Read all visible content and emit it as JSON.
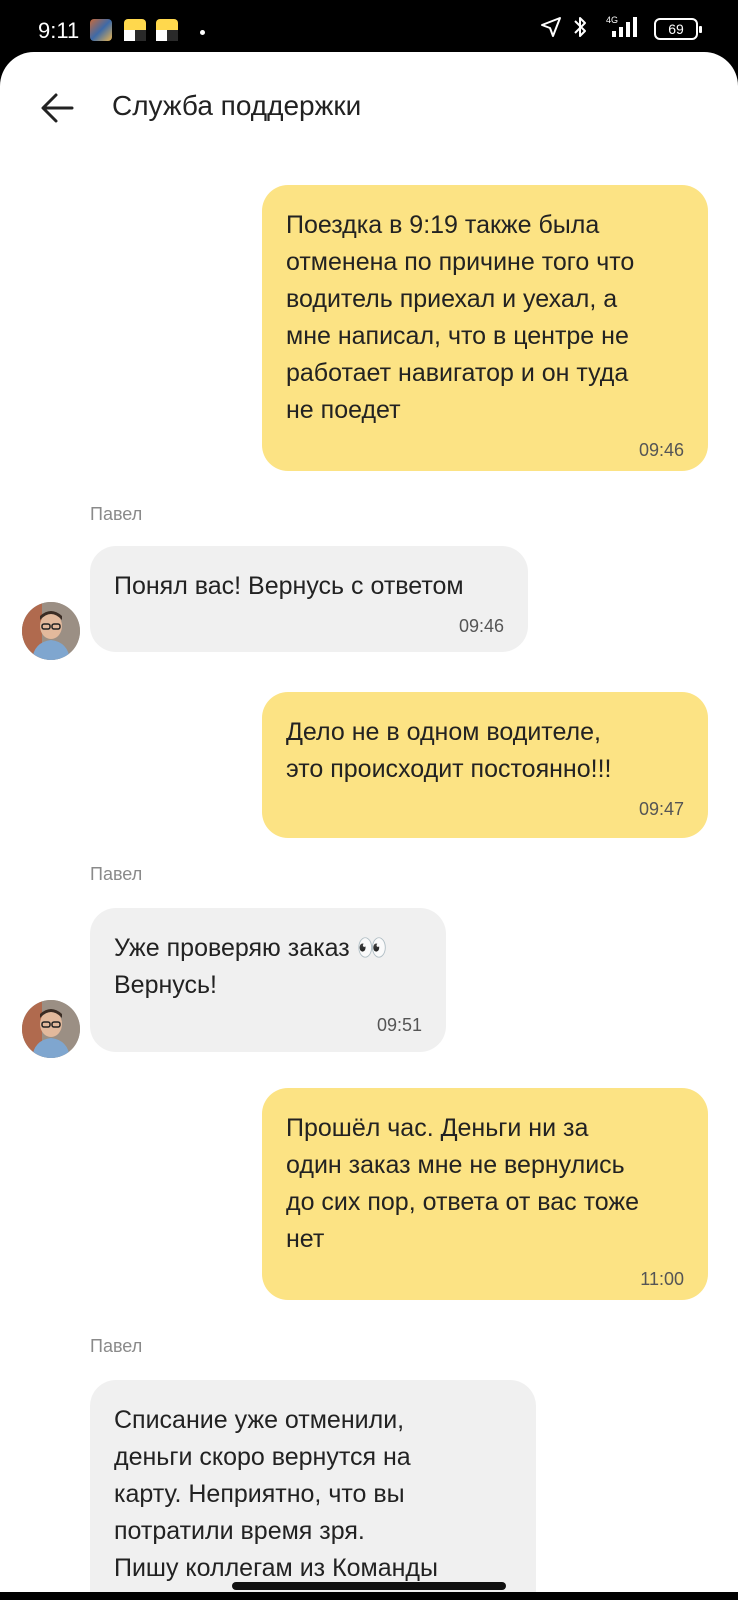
{
  "status_bar": {
    "time": "9:11",
    "network": "4G",
    "battery": "69"
  },
  "header": {
    "title": "Служба поддержки",
    "back_icon": "arrow-left-icon"
  },
  "messages": [
    {
      "direction": "out",
      "text": "Поездка в 9:19 также была\nотменена по причине того что\nводитель приехал и уехал, а\nмне написал, что в центре не\nработает навигатор и он туда\nне поедет",
      "time": "09:46"
    },
    {
      "direction": "in",
      "sender": "Павел",
      "text": "Понял вас! Вернусь с ответом",
      "time": "09:46"
    },
    {
      "direction": "out",
      "text": "Дело не в одном водителе,\nэто происходит постоянно!!!",
      "time": "09:47"
    },
    {
      "direction": "in",
      "sender": "Павел",
      "text": "Уже проверяю заказ 👀\nВернусь!",
      "time": "09:51"
    },
    {
      "direction": "out",
      "text": "Прошёл час. Деньги ни за\nодин заказ мне не вернулись\nдо сих пор, ответа от вас тоже\nнет",
      "time": "11:00"
    },
    {
      "direction": "in",
      "sender": "Павел",
      "text": "Списание уже отменили,\nденьги скоро вернутся на\nкарту. Неприятно, что вы\nпотратили время зря.\nПишу коллегам из Команды",
      "time": ""
    }
  ],
  "colors": {
    "outgoing_bubble": "#fce384",
    "incoming_bubble": "#f0f0f0",
    "sender_name": "#8a8a8a"
  }
}
